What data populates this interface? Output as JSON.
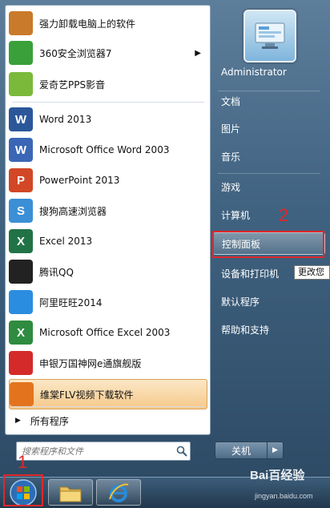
{
  "programs": [
    {
      "label": "强力卸载电脑上的软件",
      "icon": "uninstaller-icon",
      "color": "#c97a2a"
    },
    {
      "label": "360安全浏览器7",
      "icon": "360-browser-icon",
      "color": "#3aa03a",
      "has_submenu": true
    },
    {
      "label": "爱奇艺PPS影音",
      "icon": "pps-player-icon",
      "color": "#7ab93a"
    },
    {
      "label": "Word 2013",
      "icon": "word-icon",
      "color": "#2b579a",
      "glyph": "W"
    },
    {
      "label": "Microsoft Office Word 2003",
      "icon": "word-2003-icon",
      "color": "#3a66b5",
      "glyph": "W"
    },
    {
      "label": "PowerPoint 2013",
      "icon": "powerpoint-icon",
      "color": "#d24726",
      "glyph": "P"
    },
    {
      "label": "搜狗高速浏览器",
      "icon": "sogou-browser-icon",
      "color": "#3b8fd6",
      "glyph": "S"
    },
    {
      "label": "Excel 2013",
      "icon": "excel-icon",
      "color": "#217346",
      "glyph": "X"
    },
    {
      "label": "腾讯QQ",
      "icon": "qq-penguin-icon",
      "color": "#222222"
    },
    {
      "label": "阿里旺旺2014",
      "icon": "aliwangwang-icon",
      "color": "#2b8de0"
    },
    {
      "label": "Microsoft Office Excel 2003",
      "icon": "excel-2003-icon",
      "color": "#2e8b3f",
      "glyph": "X"
    },
    {
      "label": "申银万国神网e通旗舰版",
      "icon": "shenyin-icon",
      "color": "#d42a2a"
    },
    {
      "label": "维棠FLV视频下载软件",
      "icon": "weitang-flv-icon",
      "color": "#e3741d",
      "highlighted": true
    }
  ],
  "all_programs_label": "所有程序",
  "search": {
    "placeholder": "搜索程序和文件"
  },
  "right_items": [
    {
      "label": "Administrator",
      "name": "user-administrator"
    },
    {
      "label": "文档",
      "name": "documents"
    },
    {
      "label": "图片",
      "name": "pictures"
    },
    {
      "label": "音乐",
      "name": "music"
    },
    {
      "label": "游戏",
      "name": "games"
    },
    {
      "label": "计算机",
      "name": "computer"
    },
    {
      "label": "控制面板",
      "name": "control-panel",
      "active": true
    },
    {
      "label": "设备和打印机",
      "name": "devices-and-printers"
    },
    {
      "label": "默认程序",
      "name": "default-programs"
    },
    {
      "label": "帮助和支持",
      "name": "help-and-support"
    }
  ],
  "tooltip": "更改您",
  "shutdown_label": "关机",
  "annotations": {
    "step1": "1",
    "step2": "2"
  },
  "watermark": {
    "main": "Bai百经验",
    "sub": "jingyan.baidu.com"
  }
}
